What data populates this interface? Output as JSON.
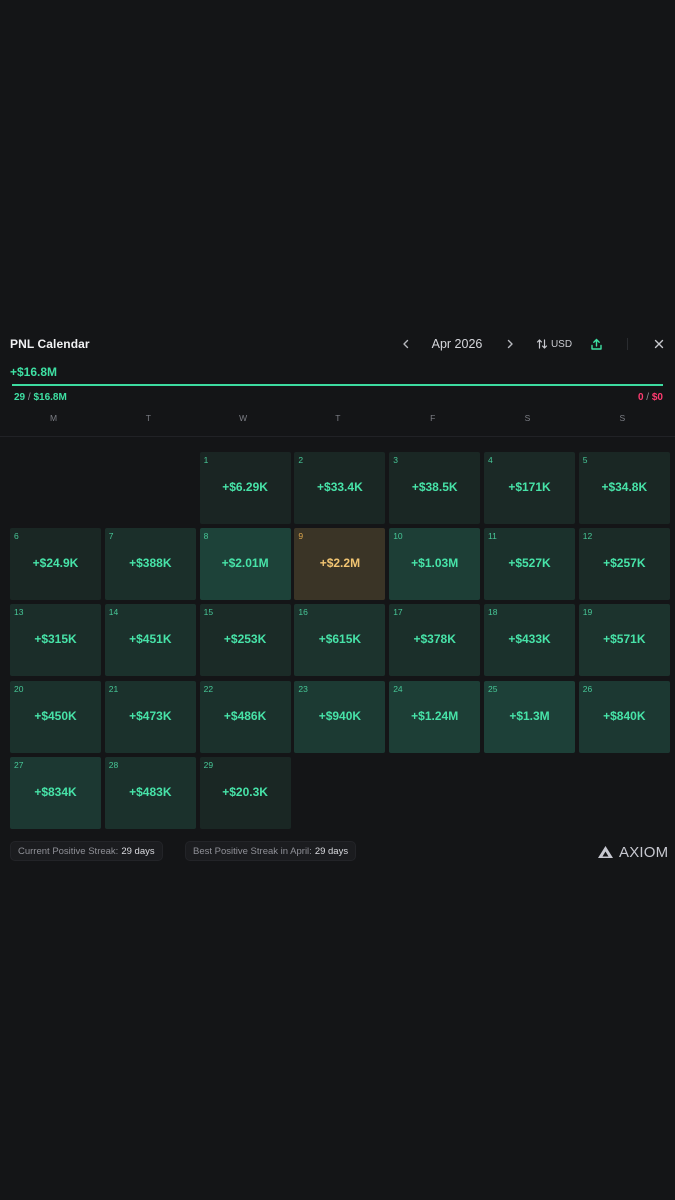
{
  "header": {
    "title": "PNL Calendar",
    "month": "Apr 2026",
    "currency": "USD"
  },
  "summary": {
    "total_pnl": "+$16.8M",
    "win_days": "29",
    "win_amount": "$16.8M",
    "loss_days": "0",
    "loss_amount": "$0",
    "win_fraction": 1.0
  },
  "weekdays": [
    "M",
    "T",
    "W",
    "T",
    "F",
    "S",
    "S"
  ],
  "first_weekday_index": 2,
  "days": [
    {
      "day": "1",
      "pnl": "+$6.29K",
      "intensity": 0.05
    },
    {
      "day": "2",
      "pnl": "+$33.4K",
      "intensity": 0.1
    },
    {
      "day": "3",
      "pnl": "+$38.5K",
      "intensity": 0.1
    },
    {
      "day": "4",
      "pnl": "+$171K",
      "intensity": 0.15
    },
    {
      "day": "5",
      "pnl": "+$34.8K",
      "intensity": 0.1
    },
    {
      "day": "6",
      "pnl": "+$24.9K",
      "intensity": 0.1
    },
    {
      "day": "7",
      "pnl": "+$388K",
      "intensity": 0.3
    },
    {
      "day": "8",
      "pnl": "+$2.01M",
      "intensity": 0.8
    },
    {
      "day": "9",
      "pnl": "+$2.2M",
      "intensity": 1.0,
      "best": true
    },
    {
      "day": "10",
      "pnl": "+$1.03M",
      "intensity": 0.7
    },
    {
      "day": "11",
      "pnl": "+$527K",
      "intensity": 0.35
    },
    {
      "day": "12",
      "pnl": "+$257K",
      "intensity": 0.2
    },
    {
      "day": "13",
      "pnl": "+$315K",
      "intensity": 0.25
    },
    {
      "day": "14",
      "pnl": "+$451K",
      "intensity": 0.35
    },
    {
      "day": "15",
      "pnl": "+$253K",
      "intensity": 0.2
    },
    {
      "day": "16",
      "pnl": "+$615K",
      "intensity": 0.4
    },
    {
      "day": "17",
      "pnl": "+$378K",
      "intensity": 0.3
    },
    {
      "day": "18",
      "pnl": "+$433K",
      "intensity": 0.35
    },
    {
      "day": "19",
      "pnl": "+$571K",
      "intensity": 0.4
    },
    {
      "day": "20",
      "pnl": "+$450K",
      "intensity": 0.35
    },
    {
      "day": "21",
      "pnl": "+$473K",
      "intensity": 0.35
    },
    {
      "day": "22",
      "pnl": "+$486K",
      "intensity": 0.35
    },
    {
      "day": "23",
      "pnl": "+$940K",
      "intensity": 0.6
    },
    {
      "day": "24",
      "pnl": "+$1.24M",
      "intensity": 0.7
    },
    {
      "day": "25",
      "pnl": "+$1.3M",
      "intensity": 0.75
    },
    {
      "day": "26",
      "pnl": "+$840K",
      "intensity": 0.55
    },
    {
      "day": "27",
      "pnl": "+$834K",
      "intensity": 0.55
    },
    {
      "day": "28",
      "pnl": "+$483K",
      "intensity": 0.35
    },
    {
      "day": "29",
      "pnl": "+$20.3K",
      "intensity": 0.1
    }
  ],
  "footer": {
    "current_streak_label": "Current Positive Streak:",
    "current_streak_value": "29 days",
    "best_streak_label": "Best Positive Streak in April:",
    "best_streak_value": "29 days",
    "brand": "AXIOM"
  },
  "icons": {
    "prev": "chevron-left-icon",
    "next": "chevron-right-icon",
    "currency": "swap-vertical-icon",
    "export": "share-upload-icon",
    "close": "close-icon",
    "brand": "axiom-logo-icon"
  },
  "colors": {
    "background": "#141517",
    "profit": "#3ee0a3",
    "loss": "#ff3b70",
    "best_day": "#f2c572"
  }
}
